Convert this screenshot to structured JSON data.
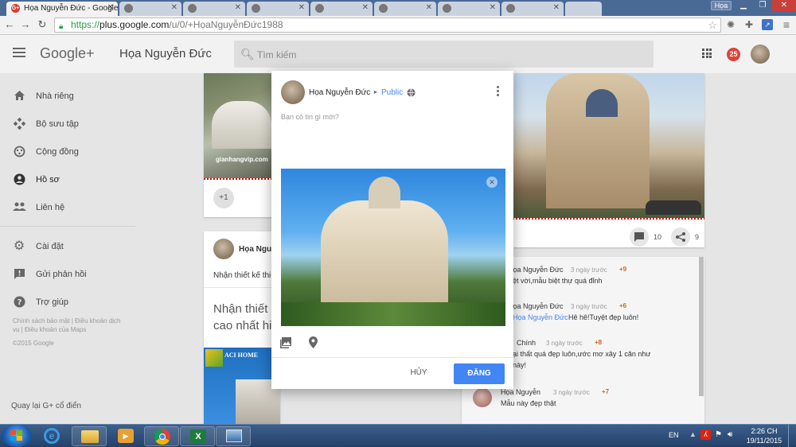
{
  "browser": {
    "tabs": [
      {
        "title": "Họa Nguyễn Đức - Google",
        "active": true
      },
      {
        "title": "",
        "active": false
      },
      {
        "title": "",
        "active": false
      },
      {
        "title": "",
        "active": false
      },
      {
        "title": "",
        "active": false
      },
      {
        "title": "",
        "active": false
      },
      {
        "title": "",
        "active": false
      }
    ],
    "user_badge": "Họa",
    "url_scheme": "https://",
    "url_host": "plus.google.com",
    "url_path": "/u/0/+HọaNguyễnĐức1988"
  },
  "header": {
    "logo": "Google+",
    "profile_name": "Họa Nguyễn Đức",
    "search_placeholder": "Tìm kiếm",
    "notification_count": "25"
  },
  "sidebar": {
    "items": [
      {
        "label": "Nhà riêng",
        "icon": "home-icon"
      },
      {
        "label": "Bộ sưu tập",
        "icon": "collections-icon"
      },
      {
        "label": "Cộng đồng",
        "icon": "communities-icon"
      },
      {
        "label": "Hồ sơ",
        "icon": "profile-icon"
      },
      {
        "label": "Liên hệ",
        "icon": "people-icon"
      },
      {
        "label": "Cài đặt",
        "icon": "settings-icon"
      },
      {
        "label": "Gửi phản hồi",
        "icon": "feedback-icon"
      },
      {
        "label": "Trợ giúp",
        "icon": "help-icon"
      }
    ],
    "footer_links": "Chính sách bảo mật | Điều khoản dịch vụ | Điều khoản của Maps",
    "copyright": "©2015 Google",
    "classic_link": "Quay lại G+ cổ điển"
  },
  "feed": {
    "left_top": {
      "watermark": "gianhangvip.com",
      "plus_one": "+1"
    },
    "left_post": {
      "author": "Họa Nguyễ",
      "caption": "Nhận thiết kế thi",
      "big_text_line1": "Nhận thiết k",
      "big_text_line2": "cao nhất hiệ",
      "banner_brand": "ACI HOME"
    },
    "right_card": {
      "comment_count": "10",
      "share_count": "9",
      "comments": [
        {
          "name": "Họa Nguyễn Đức",
          "time": "3 ngày trước",
          "plus": "+9",
          "text": "ệt vời,mẫu biệt thự quá đỉnh",
          "mention": ""
        },
        {
          "name": "Họa Nguyễn Đức",
          "time": "3 ngày trước",
          "plus": "+6",
          "mention": "Họa Nguyễn Đức",
          "text": "Hê hê!Tuyệt đẹp luôn!"
        },
        {
          "name": "Chính",
          "time": "3 ngày trước",
          "plus": "+8",
          "text": "ại thất quá đẹp luôn,ước mơ xây 1 căn như",
          "text2": "này!",
          "mention": ""
        },
        {
          "name": "Họa Nguyễn",
          "time": "3 ngày trước",
          "plus": "+7",
          "text": "Mẫu này đẹp thật",
          "mention": ""
        }
      ]
    }
  },
  "modal": {
    "author": "Họa Nguyễn Đức",
    "audience": "Public",
    "placeholder": "Bạn có tin gì mới?",
    "cancel_label": "HỦY",
    "post_label": "ĐĂNG"
  },
  "taskbar": {
    "language": "EN",
    "time": "2:26 CH",
    "date": "19/11/2015"
  }
}
